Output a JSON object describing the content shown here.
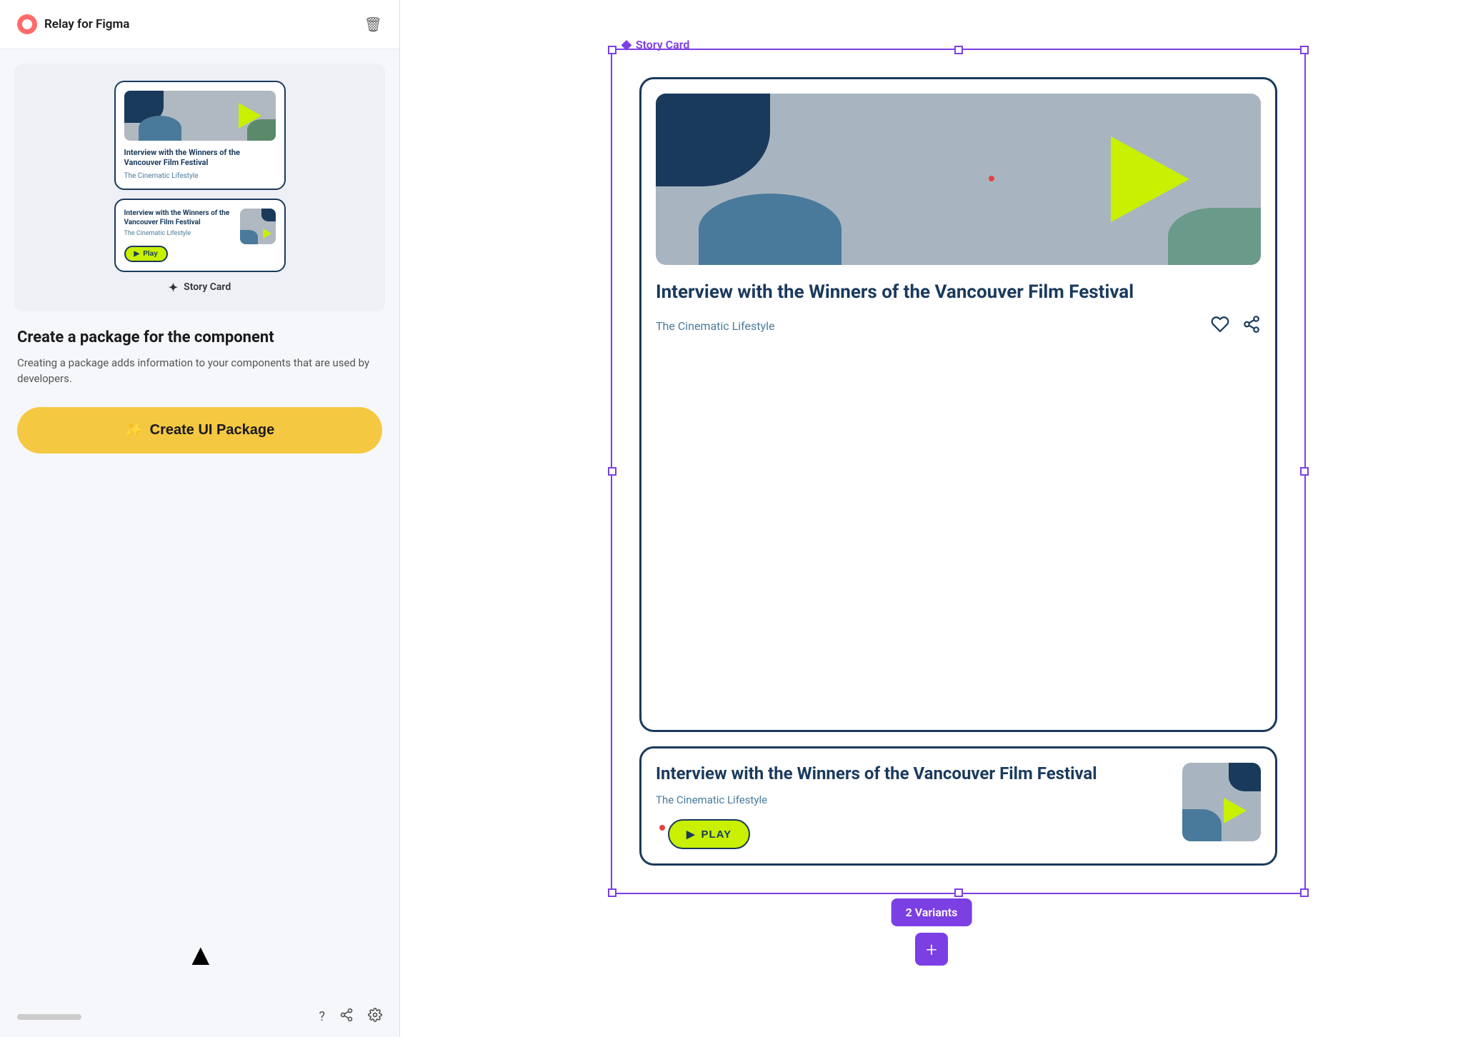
{
  "app": {
    "name": "Relay for Figma",
    "trash_label": "🗑"
  },
  "preview": {
    "component_name": "Story Card",
    "sparkle_icon": "✦"
  },
  "card_v1": {
    "title": "Interview with the Winners of the Vancouver Film Festival",
    "subtitle": "The Cinematic Lifestyle"
  },
  "card_v2": {
    "title": "Interview with the Winners of the Vancouver Film Festival",
    "subtitle": "The Cinematic Lifestyle",
    "play_label": "Play"
  },
  "description": {
    "heading": "Create a package for the component",
    "body": "Creating a package adds information to your components that are used by developers."
  },
  "create_button": {
    "label": "Create UI Package",
    "icon": "✨"
  },
  "footer": {
    "help_icon": "?",
    "share_icon": "share",
    "settings_icon": "⚙"
  },
  "right_panel": {
    "story_card_label": "Story Card",
    "diamond_icon": "◆",
    "card1_title": "Interview with the Winners of the Vancouver Film Festival",
    "card1_subtitle": "The Cinematic Lifestyle",
    "card1_like_icon": "♡",
    "card1_share_icon": "share",
    "card2_title": "Interview with the Winners of the Vancouver Film Festival",
    "card2_subtitle": "The Cinematic Lifestyle",
    "card2_play_label": "PLAY",
    "variants_label": "2 Variants",
    "add_icon": "+"
  },
  "cursor": "▲"
}
